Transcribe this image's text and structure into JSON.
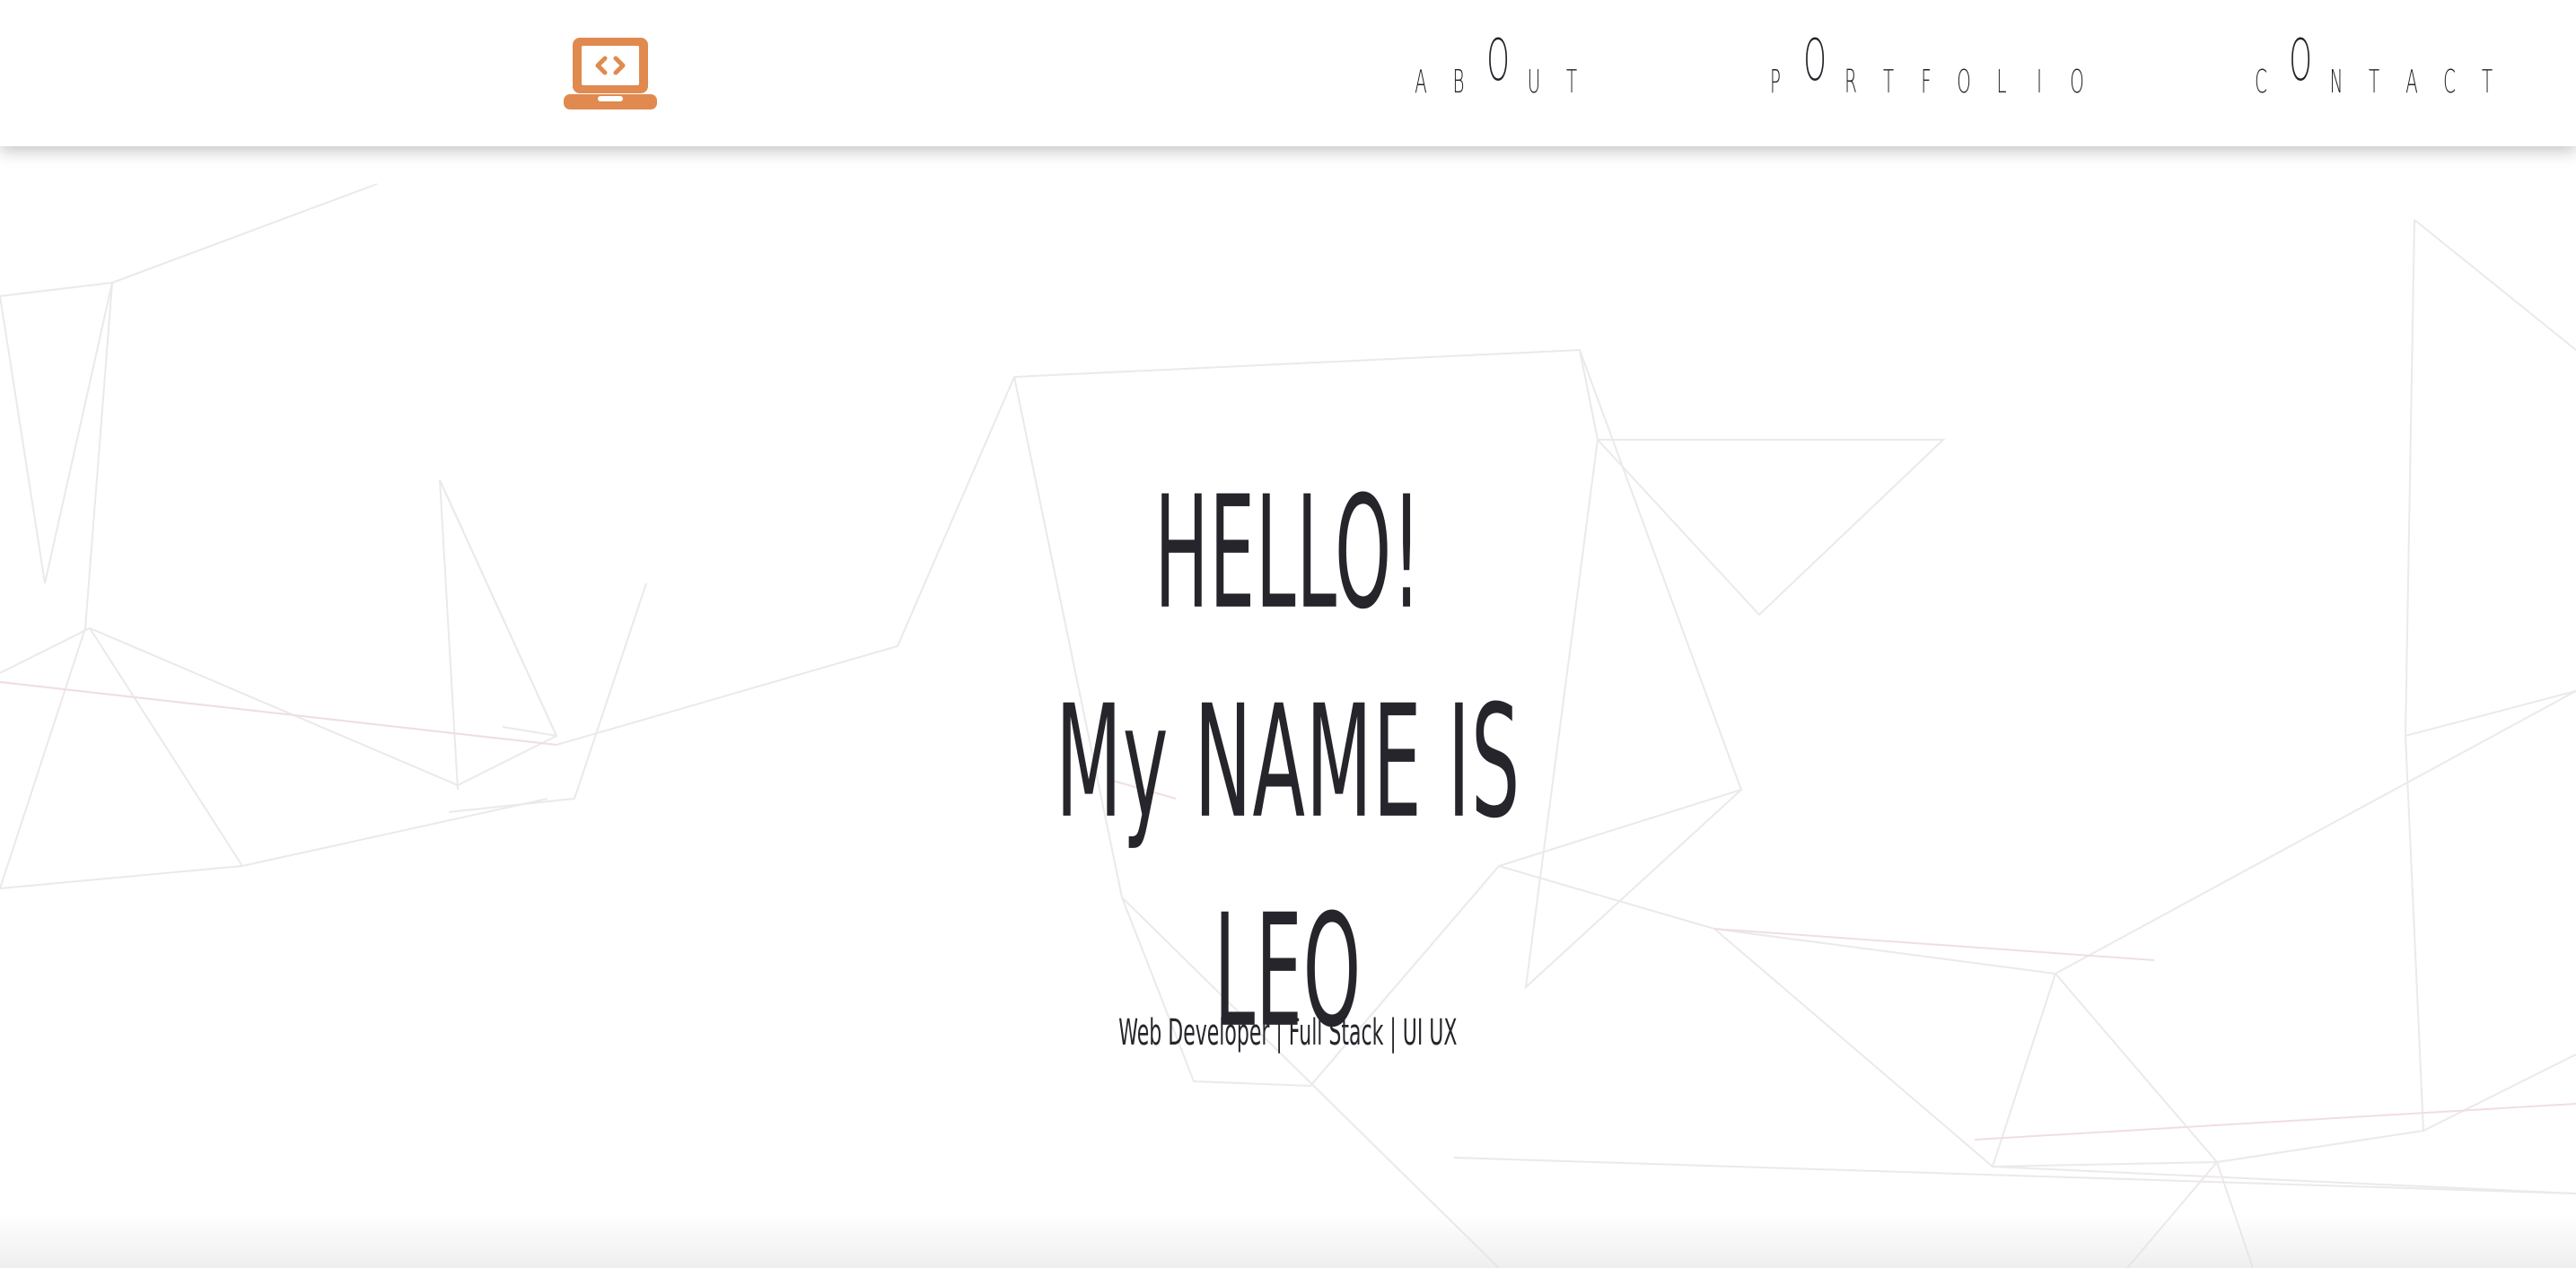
{
  "header": {
    "logo_icon": "laptop-code-icon",
    "logo_color": "#e08a4f",
    "nav": [
      {
        "label": "abOut",
        "letters": [
          "A",
          "B",
          "O",
          "U",
          "T"
        ]
      },
      {
        "label": "pOrtfolio",
        "letters": [
          "P",
          "O",
          "R",
          "T",
          "F",
          "O",
          "L",
          "I",
          "O"
        ]
      },
      {
        "label": "cOntact",
        "letters": [
          "C",
          "O",
          "N",
          "T",
          "A",
          "C",
          "T"
        ]
      }
    ]
  },
  "hero": {
    "line1": "HELLO!",
    "line2": "My NAME IS",
    "line3": "LEO",
    "subtitle": "Web Developer | Full Stack | UI UX"
  },
  "colors": {
    "background": "#ffffff",
    "text": "#25252b",
    "accent": "#e08a4f",
    "network_lines": "#e7e2e6"
  }
}
